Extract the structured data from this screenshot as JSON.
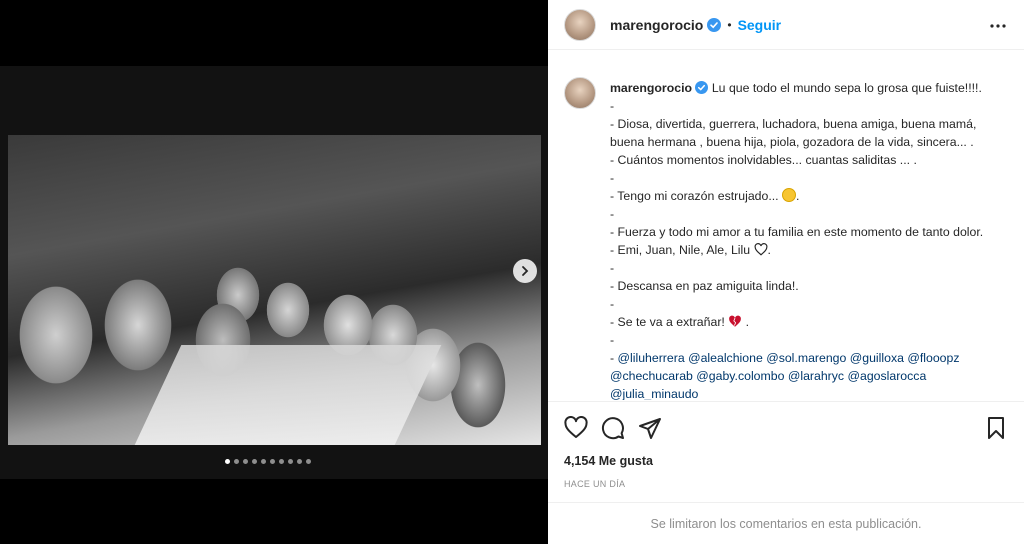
{
  "post": {
    "username": "marengorocio",
    "follow_label": "Seguir",
    "separator": "•",
    "caption_lines": [
      "Lu que todo el mundo sepa lo grosa que fuiste!!!!.",
      "-",
      "- Diosa, divertida, guerrera, luchadora, buena amiga, buena mamá, buena hermana , buena hija, piola, gozadora de la vida, sincera... .",
      "- Cuántos momentos inolvidables... cuantas saliditas ... .",
      "-",
      "- Tengo mi corazón estrujado...",
      "-",
      "- Fuerza y todo mi amor a tu familia en este momento de tanto dolor.",
      "- Emi, Juan, Nile, Ale, Lilu",
      "-",
      "- Descansa en paz amiguita linda!.",
      "-",
      "- Se te va a extrañar!",
      "-"
    ],
    "mentions_line_1": "@liluherrera @alealchione @sol.marengo @guilloxa @flooopz",
    "mentions_line_2": "@chechucarab @gaby.colombo @larahryc @agoslarocca",
    "mentions_line_3": "@julia_minaudo",
    "mention_prefix": "- ",
    "sad_emoji": "sad-face-emoji",
    "heart_emoji": "broken-heart-emoji",
    "heart_suffix": " .",
    "likes": "4,154 Me gusta",
    "time_ago": "HACE UN DÍA",
    "comments_disabled": "Se limitaron los comentarios en esta publicación."
  },
  "carousel": {
    "slides_count": 10,
    "active_index": 0
  },
  "colors": {
    "accent": "#0095f6",
    "mention": "#00376b",
    "verified": "#3897f0",
    "heart": "#c8102e"
  }
}
